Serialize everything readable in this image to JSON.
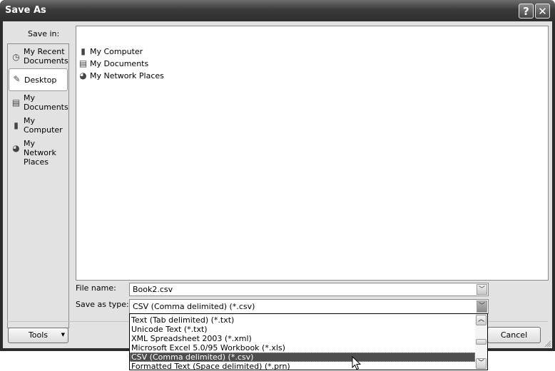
{
  "window": {
    "title": "Save As",
    "help_glyph": "?",
    "close_glyph": "✕"
  },
  "save_in": {
    "label": "Save in:",
    "value": "Desktop",
    "icon": "desktop-icon"
  },
  "toolbar": {
    "icons": [
      "back-icon",
      "up-folder-icon",
      "delete-icon",
      "new-folder-icon",
      "views-icon"
    ]
  },
  "places_bar": {
    "items": [
      {
        "label": "My Recent Documents",
        "line1": "My Recent",
        "line2": "Documents",
        "icon": "recent-documents-icon",
        "selected": false
      },
      {
        "label": "Desktop",
        "line1": "Desktop",
        "line2": "",
        "icon": "desktop-icon",
        "selected": true
      },
      {
        "label": "My Documents",
        "line1": "My",
        "line2": "Documents",
        "icon": "my-documents-icon",
        "selected": false
      },
      {
        "label": "My Computer",
        "line1": "My",
        "line2": "Computer",
        "icon": "my-computer-icon",
        "selected": false
      },
      {
        "label": "My Network Places",
        "line1": "My Network",
        "line2": "Places",
        "icon": "network-places-icon",
        "selected": false
      }
    ]
  },
  "file_list": {
    "items": [
      {
        "name": "My Computer",
        "icon": "my-computer-icon"
      },
      {
        "name": "My Documents",
        "icon": "my-documents-icon"
      },
      {
        "name": "My Network Places",
        "icon": "network-places-icon"
      }
    ]
  },
  "file_name": {
    "label": "File name:",
    "value": "Book2.csv"
  },
  "save_as_type": {
    "label": "Save as type:",
    "value": "CSV (Comma delimited) (*.csv)",
    "options": [
      "Text (Tab delimited) (*.txt)",
      "Unicode Text (*.txt)",
      "XML Spreadsheet 2003 (*.xml)",
      "Microsoft Excel 5.0/95 Workbook (*.xls)",
      "CSV (Comma delimited) (*.csv)",
      "Formatted Text (Space delimited) (*.prn)"
    ],
    "highlighted_index": 4
  },
  "buttons": {
    "tools": "Tools",
    "cancel": "Cancel"
  }
}
